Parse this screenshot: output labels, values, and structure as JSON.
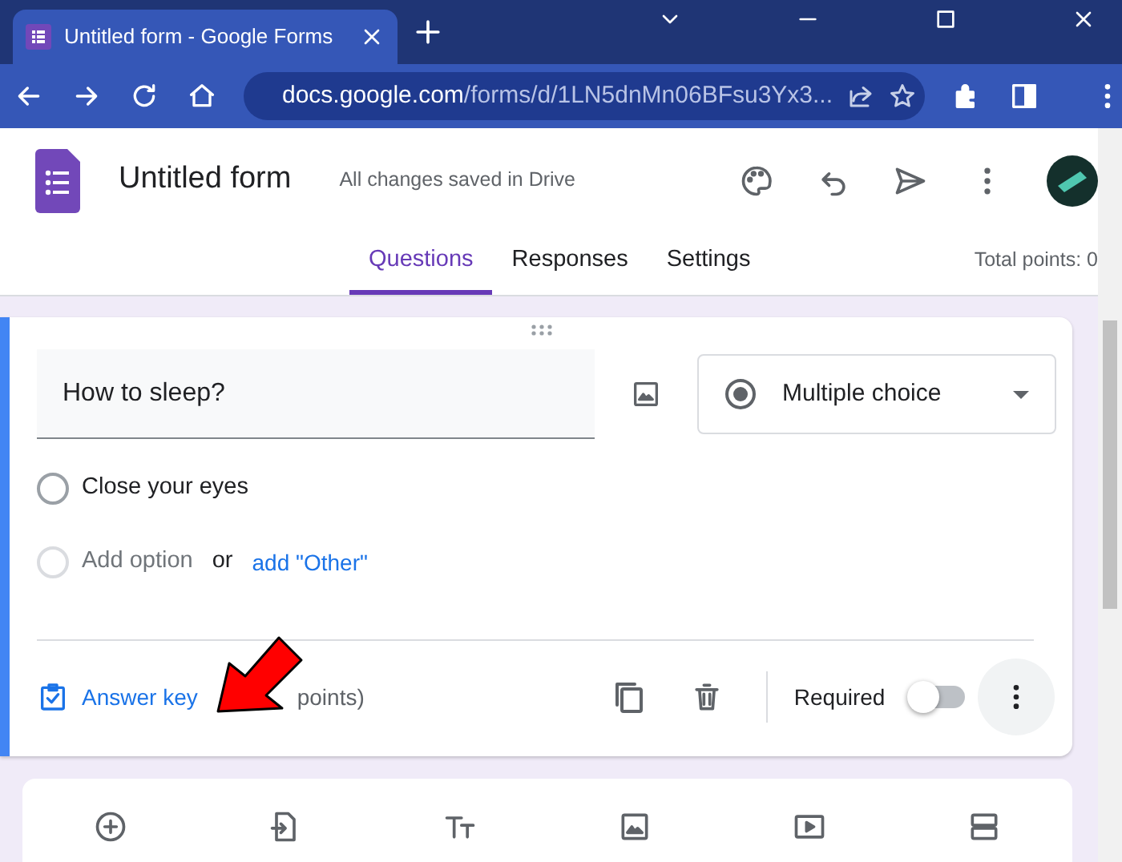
{
  "browser": {
    "tab_title": "Untitled form - Google Forms",
    "url_host": "docs.google.com",
    "url_path": "/forms/d/1LN5dnMn06BFsu3Yx3..."
  },
  "header": {
    "title": "Untitled form",
    "save_status": "All changes saved in Drive"
  },
  "tabs": [
    {
      "label": "Questions",
      "selected": true
    },
    {
      "label": "Responses",
      "selected": false
    },
    {
      "label": "Settings",
      "selected": false
    }
  ],
  "total_points": "Total points: 0",
  "question": {
    "title": "How to sleep?",
    "type": "Multiple choice",
    "options": [
      {
        "label": "Close your eyes",
        "selected": false
      }
    ],
    "add_option": "Add option",
    "or": "or",
    "add_other": "add \"Other\"",
    "answer_key": "Answer key",
    "points": "points)",
    "required_label": "Required",
    "required": false
  }
}
